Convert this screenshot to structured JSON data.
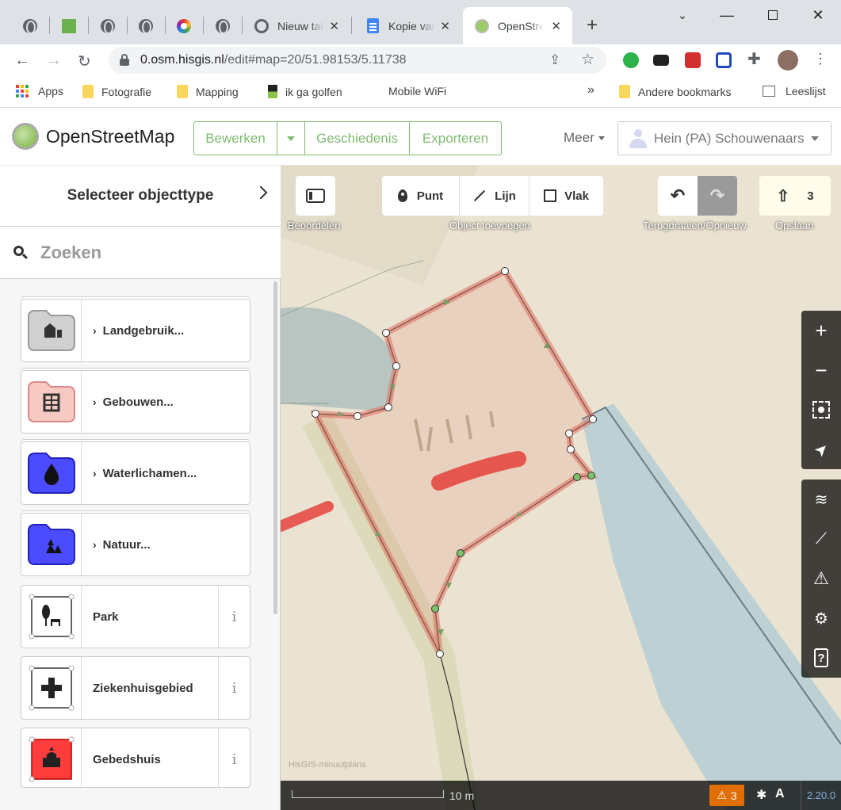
{
  "browser": {
    "tabs": [
      {
        "title": "",
        "icon": "globe-icon"
      },
      {
        "title": "",
        "icon": "green-square-icon"
      },
      {
        "title": "",
        "icon": "globe-icon"
      },
      {
        "title": "",
        "icon": "globe-icon"
      },
      {
        "title": "",
        "icon": "color-ring-icon"
      },
      {
        "title": "",
        "icon": "globe-icon"
      },
      {
        "title": "Nieuw tabblad",
        "icon": "chrome-icon"
      },
      {
        "title": "Kopie van",
        "icon": "docs-icon"
      },
      {
        "title": "OpenStreetMap",
        "icon": "osm-icon"
      }
    ],
    "new_tab_label": "+",
    "url_host": "0.osm.hisgis.nl",
    "url_path": "/edit#map=20/51.98153/5.11738",
    "bookmarks": [
      {
        "label": "Apps"
      },
      {
        "label": "Fotografie"
      },
      {
        "label": "Mapping"
      },
      {
        "label": "ik ga golfen"
      },
      {
        "label": "Mobile WiFi"
      },
      {
        "label": "Andere bookmarks"
      },
      {
        "label": "Leeslijst"
      }
    ],
    "bookmarks_overflow": "»",
    "accent": "#1a73e8"
  },
  "osm": {
    "brand": "OpenStreetMap",
    "edit_label": "Bewerken",
    "history_label": "Geschiedenis",
    "export_label": "Exporteren",
    "more_label": "Meer",
    "user_name": "Hein (PA) Schouwenaars",
    "brand_green": "#7ebc6f"
  },
  "sidebar": {
    "title": "Selecteer objecttype",
    "search_placeholder": "Zoeken",
    "presets": [
      {
        "label": "Landgebruik...",
        "kind": "category",
        "icon": "landuse-folder-icon",
        "color": "#cfcfcf"
      },
      {
        "label": "Gebouwen...",
        "kind": "category",
        "icon": "buildings-folder-icon",
        "color": "#f4c5c0"
      },
      {
        "label": "Waterlichamen...",
        "kind": "category",
        "icon": "water-folder-icon",
        "color": "#5a5aff"
      },
      {
        "label": "Natuur...",
        "kind": "category",
        "icon": "nature-folder-icon",
        "color": "#5a5aff"
      },
      {
        "label": "Park",
        "kind": "preset",
        "icon": "park-icon",
        "color": "#ffffff"
      },
      {
        "label": "Ziekenhuisgebied",
        "kind": "preset",
        "icon": "hospital-icon",
        "color": "#ffffff"
      },
      {
        "label": "Gebedshuis",
        "kind": "preset",
        "icon": "place-of-worship-icon",
        "color": "#ff4040"
      }
    ],
    "info_label": "i"
  },
  "map": {
    "review_label": "Beoordelen",
    "add_point": "Punt",
    "add_line": "Lijn",
    "add_area": "Vlak",
    "add_group_label": "Object toevoegen",
    "undo_redo_label": "Terugdraaien/Opnieuw",
    "save_label": "Opslaan",
    "save_count": "3",
    "background_source": "HisGIS-minuutplans",
    "scale_label": "10 m",
    "issues_count": "3",
    "version": "2.20.0",
    "issues_color": "#e06e00",
    "area_color": "#e06e5f"
  }
}
